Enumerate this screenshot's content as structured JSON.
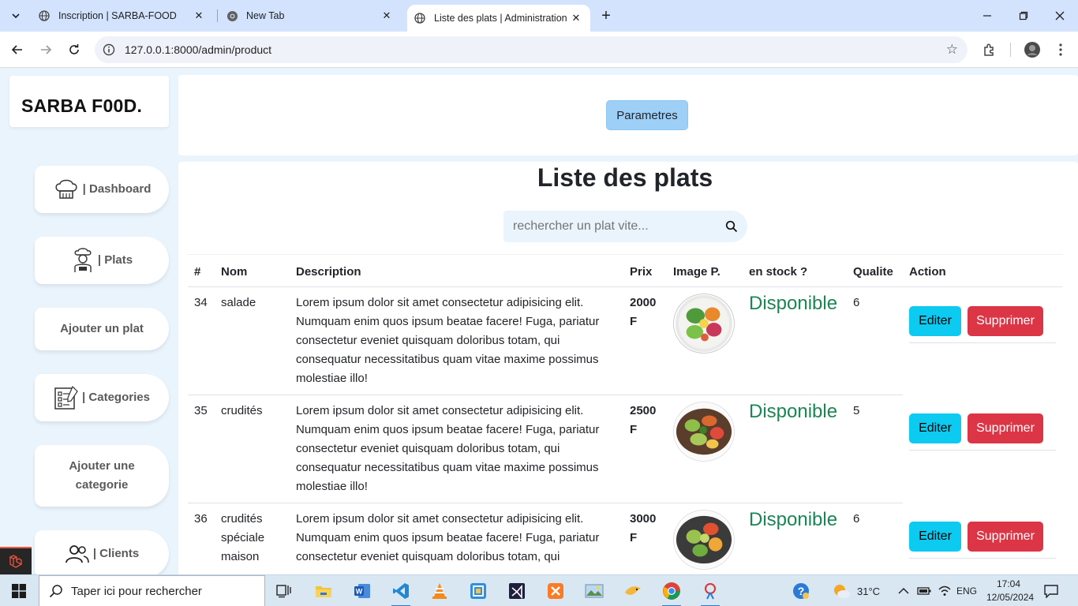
{
  "browser": {
    "tabs": [
      {
        "title": "Inscription | SARBA-FOOD",
        "active": false
      },
      {
        "title": "New Tab",
        "active": false
      },
      {
        "title": "Liste des plats | Administration",
        "active": true
      }
    ],
    "url": "127.0.0.1:8000/admin/product"
  },
  "sidebar": {
    "brand": "SARBA F00D.",
    "items": [
      {
        "label": "| Dashboard",
        "icon": "chef-hat-icon"
      },
      {
        "label": "| Plats",
        "icon": "chef-icon"
      },
      {
        "label": "Ajouter un plat"
      },
      {
        "label": "| Categories",
        "icon": "checklist-icon"
      },
      {
        "label": "Ajouter une categorie"
      },
      {
        "label": "| Clients",
        "icon": "users-icon"
      }
    ]
  },
  "header": {
    "parametres_label": "Parametres"
  },
  "main": {
    "title": "Liste des plats",
    "search_placeholder": "rechercher un plat vite...",
    "columns": [
      "#",
      "Nom",
      "Description",
      "Prix",
      "Image P.",
      "en stock ?",
      "Qualite",
      "Action"
    ],
    "rows": [
      {
        "id": "34",
        "name": "salade",
        "description": "Lorem ipsum dolor sit amet consectetur adipisicing elit. Numquam enim quos ipsum beatae facere! Fuga, pariatur consectetur eveniet quisquam doloribus totam, qui consequatur necessitatibus quam vitae maxime possimus molestiae illo!",
        "price": "2000 F",
        "stock": "Disponible",
        "quality": "6",
        "edit_label": "Editer",
        "delete_label": "Supprimer"
      },
      {
        "id": "35",
        "name": "crudités",
        "description": "Lorem ipsum dolor sit amet consectetur adipisicing elit. Numquam enim quos ipsum beatae facere! Fuga, pariatur consectetur eveniet quisquam doloribus totam, qui consequatur necessitatibus quam vitae maxime possimus molestiae illo!",
        "price": "2500 F",
        "stock": "Disponible",
        "quality": "5",
        "edit_label": "Editer",
        "delete_label": "Supprimer"
      },
      {
        "id": "36",
        "name": "crudités spéciale maison",
        "description": "Lorem ipsum dolor sit amet consectetur adipisicing elit. Numquam enim quos ipsum beatae facere! Fuga, pariatur consectetur eveniet quisquam doloribus totam, qui",
        "price": "3000 F",
        "stock": "Disponible",
        "quality": "6",
        "edit_label": "Editer",
        "delete_label": "Supprimer"
      }
    ]
  },
  "taskbar": {
    "search_placeholder": "Taper ici pour rechercher",
    "weather": "31°C",
    "language": "ENG",
    "time": "17:04",
    "date": "12/05/2024"
  },
  "colors": {
    "accent_blue": "#9ecff7",
    "edit_button": "#0dcaf0",
    "delete_button": "#dc3545",
    "stock_green": "#198754",
    "page_bg": "#eaf4fc"
  }
}
